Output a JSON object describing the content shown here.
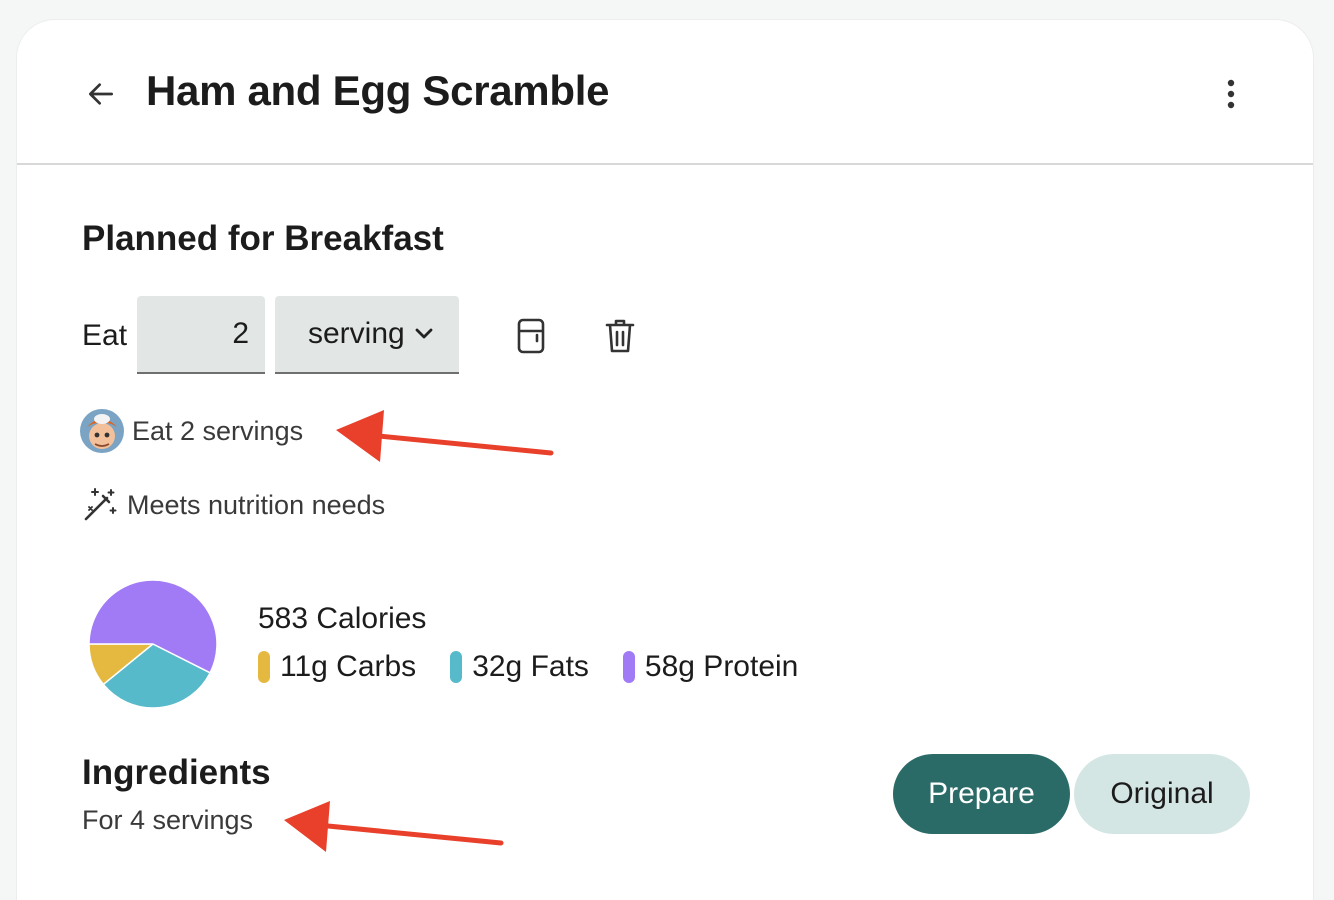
{
  "header": {
    "title": "Ham and Egg Scramble",
    "back_icon": "arrow-left-icon",
    "more_icon": "more-vert-icon"
  },
  "plan": {
    "section_title": "Planned for Breakfast",
    "eat_label": "Eat",
    "quantity": "2",
    "unit": "serving",
    "note_user": "Eat 2 servings",
    "note_nutrition": "Meets nutrition needs"
  },
  "nutrition": {
    "calories_text": "583 Calories",
    "carbs_text": "11g Carbs",
    "fats_text": "32g Fats",
    "protein_text": "58g Protein"
  },
  "chart_data": {
    "type": "pie",
    "slices": [
      {
        "label": "Carbs",
        "value": 11,
        "color": "#e5b93f"
      },
      {
        "label": "Fats",
        "value": 32,
        "color": "#56bacb"
      },
      {
        "label": "Protein",
        "value": 58,
        "color": "#a07bf5"
      }
    ]
  },
  "ingredients": {
    "title": "Ingredients",
    "subtitle": "For 4 servings",
    "toggle": {
      "prepare_label": "Prepare",
      "original_label": "Original",
      "selected": "Prepare"
    }
  },
  "colors": {
    "accent": "#2a6b68",
    "accent_light": "#d4e6e4",
    "annotation_arrow": "#e8402a"
  }
}
